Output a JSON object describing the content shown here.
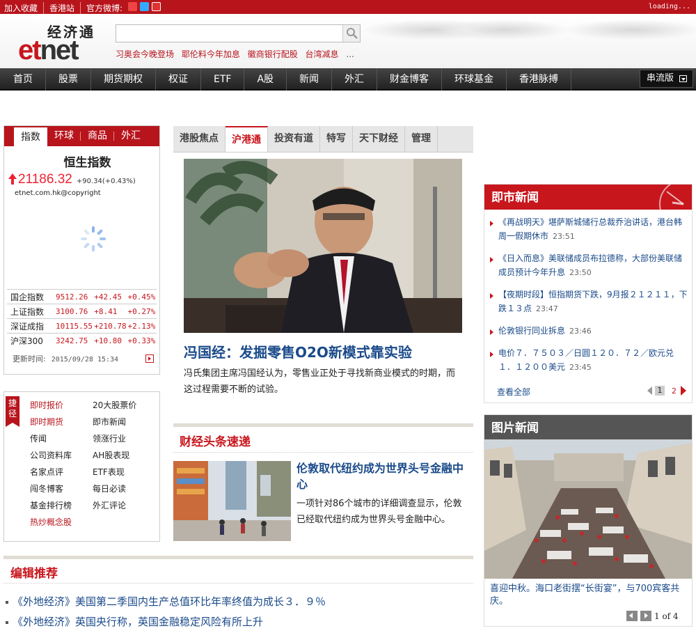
{
  "topbar": {
    "bookmark": "加入收藏",
    "hk_site": "香港站",
    "weibo": "官方微博:",
    "loading": "loading..."
  },
  "logo": {
    "cn": "经济通",
    "en_1": "et",
    "en_2": "net"
  },
  "search": {
    "value": "",
    "placeholder": ""
  },
  "hot_links": [
    "习奥会今晚登场",
    "耶伦料今年加息",
    "徽商银行配股",
    "台湾减息"
  ],
  "hot_more": "...",
  "nav": {
    "items": [
      "首页",
      "股票",
      "期货期权",
      "权证",
      "ETF",
      "A股",
      "新闻",
      "外汇",
      "财金博客",
      "环球基金",
      "香港脉搏"
    ],
    "stream": "串流版"
  },
  "index_box": {
    "tabs": [
      "指数",
      "环球",
      "商品",
      "外汇"
    ],
    "hsi_title": "恒生指数",
    "hsi_value": "21186.32",
    "hsi_change": "+90.34(+0.43%)",
    "copyright": "etnet.com.hk@copyright",
    "rows": [
      {
        "name": "国企指数",
        "val": "9512.26",
        "chg": "+42.45",
        "pct": "+0.45%"
      },
      {
        "name": "上证指数",
        "val": "3100.76",
        "chg": "+8.41",
        "pct": "+0.27%"
      },
      {
        "name": "深证成指",
        "val": "10115.55",
        "chg": "+210.78",
        "pct": "+2.13%"
      },
      {
        "name": "沪深300",
        "val": "3242.75",
        "chg": "+10.80",
        "pct": "+0.33%"
      }
    ],
    "update_label": "更新时间:",
    "update_time": "2015/09/28 15:34"
  },
  "shortcut": {
    "flag": "捷径",
    "left": [
      "即时报价",
      "即时期货",
      "传闻",
      "公司资料库",
      "名家点评",
      "闯冬博客",
      "基金排行榜",
      "热炒概念股"
    ],
    "right": [
      "20大股票价",
      "即市新闻",
      "领涨行业",
      "AH股表现",
      "ETF表现",
      "每日必读",
      "外汇评论"
    ]
  },
  "main_tabs": [
    "港股焦点",
    "沪港通",
    "投资有道",
    "特写",
    "天下财经",
    "管理"
  ],
  "feature": {
    "headline": "冯国经：发掘零售O2O新模式靠实验",
    "summary": "冯氏集团主席冯国经认为，零售业正处于寻找新商业模式的时期，而这过程需要不断的试验。"
  },
  "finance": {
    "title": "财经头条速递",
    "headline": "伦敦取代纽约成为世界头号金融中心",
    "summary": "一项针对86个城市的详细调查显示，伦敦已经取代纽约成为世界头号金融中心。"
  },
  "editor": {
    "title": "编辑推荐",
    "items": [
      "《外地经济》美国第二季国内生产总值环比年率终值为成长３．９％",
      "《外地经济》英国央行称，英国金融稳定风险有所上升"
    ]
  },
  "live_news": {
    "title": "即市新闻",
    "items": [
      {
        "text": "《再战明天》堪萨斯城储行总裁乔治讲话，港台韩周一假期休市",
        "time": "23:51"
      },
      {
        "text": "《日入而息》美联储成员布拉德称，大部份美联储成员预计今年升息",
        "time": "23:50"
      },
      {
        "text": "【夜期时段】恒指期货下跌，9月报２１２１１，下跌１３点",
        "time": "23:47"
      },
      {
        "text": "伦敦银行同业拆息",
        "time": "23:46"
      },
      {
        "text": "电价７．７５０３／日圆１２０．７２／欧元兑１．１２００美元",
        "time": "23:45"
      }
    ],
    "view_all": "查看全部",
    "page1": "1",
    "page2": "2"
  },
  "photo_news": {
    "title": "图片新闻",
    "caption": "喜迎中秋。海口老街摆“长街宴”，与700宾客共庆。",
    "pager": "1 of 4"
  },
  "colors": {
    "brand_red": "#c8161d",
    "link_blue": "#1a4a8a",
    "nav_dark": "#333333"
  }
}
